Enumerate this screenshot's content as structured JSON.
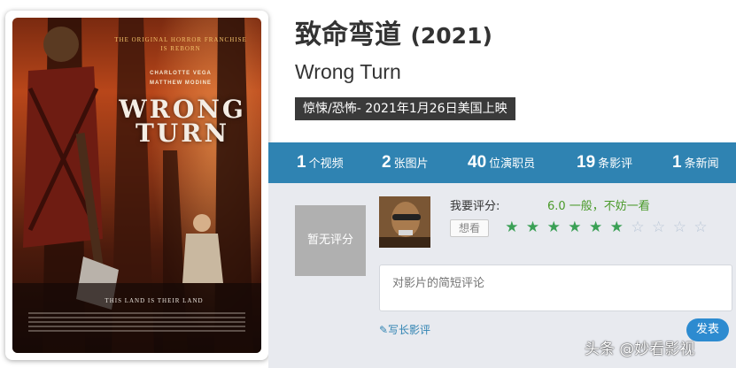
{
  "poster": {
    "tagline": "THE ORIGINAL HORROR FRANCHISE IS REBORN",
    "cast_line_1": "CHARLOTTE VEGA",
    "cast_line_2": "MATTHEW MODINE",
    "logo_line_1": "WRONG",
    "logo_line_2": "TURN",
    "bottom_tagline": "THIS LAND IS THEIR LAND"
  },
  "movie": {
    "title_cn": "致命弯道",
    "year": "(2021)",
    "title_en": "Wrong Turn",
    "genre_release": "惊悚/恐怖- 2021年1月26日美国上映"
  },
  "stats": [
    {
      "num": "1",
      "label": "个视频"
    },
    {
      "num": "2",
      "label": "张图片"
    },
    {
      "num": "40",
      "label": "位演职员"
    },
    {
      "num": "19",
      "label": "条影评"
    },
    {
      "num": "1",
      "label": "条新闻"
    }
  ],
  "rating": {
    "no_rating_text": "暂无评分",
    "my_rating_label": "我要评分:",
    "score_text": "6.0   一般，不妨一看",
    "want_label": "想看",
    "stars_total": 10,
    "stars_filled": 6,
    "comment_placeholder": "对影片的简短评论",
    "write_review_link": "✎写长影评",
    "publish_label": "发表"
  },
  "watermark": "头条 @妙看影视",
  "colors": {
    "stats_bar": "#2f83b2",
    "panel_bg": "#e8eaef",
    "star_on": "#3aa055",
    "star_off": "#b9c6d6",
    "publish_btn": "#2d8bd0"
  }
}
